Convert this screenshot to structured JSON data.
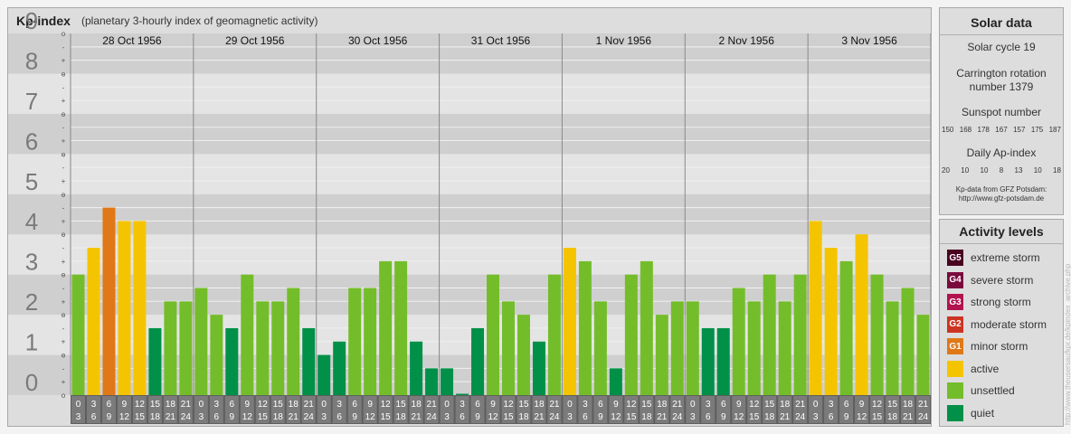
{
  "header": {
    "title": "Kp-index",
    "subtitle": "(planetary 3-hourly index of geomagnetic activity)"
  },
  "chart_data": {
    "type": "bar",
    "ylabel": "",
    "ylim": [
      0,
      9
    ],
    "yticks": [
      "0",
      "1",
      "2",
      "3",
      "4",
      "5",
      "6",
      "7",
      "8",
      "9"
    ],
    "subticks": [
      "+",
      "o",
      "-"
    ],
    "days": [
      "28 Oct 1956",
      "29 Oct 1956",
      "30 Oct 1956",
      "31 Oct 1956",
      "1 Nov 1956",
      "2 Nov 1956",
      "3 Nov 1956"
    ],
    "intervals": [
      [
        "0",
        "3"
      ],
      [
        "3",
        "6"
      ],
      [
        "6",
        "9"
      ],
      [
        "9",
        "12"
      ],
      [
        "12",
        "15"
      ],
      [
        "15",
        "18"
      ],
      [
        "18",
        "21"
      ],
      [
        "21",
        "24"
      ]
    ],
    "values": [
      [
        3.0,
        3.667,
        4.667,
        4.333,
        4.333,
        1.667,
        2.333,
        2.333
      ],
      [
        2.667,
        2.0,
        1.667,
        3.0,
        2.333,
        2.333,
        2.667,
        1.667
      ],
      [
        1.0,
        1.333,
        2.667,
        2.667,
        3.333,
        3.333,
        1.333,
        0.667
      ],
      [
        0.667,
        0.0,
        1.667,
        3.0,
        2.333,
        2.0,
        1.333,
        3.0
      ],
      [
        3.667,
        3.333,
        2.333,
        0.667,
        3.0,
        3.333,
        2.0,
        2.333
      ],
      [
        2.333,
        1.667,
        1.667,
        2.667,
        2.333,
        3.0,
        2.333,
        3.0
      ],
      [
        4.333,
        3.667,
        3.333,
        4.0,
        3.0,
        2.333,
        2.667,
        2.0
      ]
    ],
    "color_rule": "Kp<2 quiet, Kp<=3.5 unsettled, Kp<=4.5 active, Kp>4.5 minor storm"
  },
  "colors": {
    "quiet": "#009048",
    "unsettled": "#74bd2a",
    "active": "#f5c400",
    "minor_storm": "#e07818",
    "moderate_storm": "#cc3322",
    "strong_storm": "#b2134f",
    "severe_storm": "#7a0a3c",
    "extreme_storm": "#4a0220"
  },
  "solar": {
    "title": "Solar data",
    "cycle": "Solar cycle 19",
    "carrington_1": "Carrington rotation",
    "carrington_2": "number 1379",
    "sunspot_title": "Sunspot number",
    "sunspot_values": [
      "150",
      "168",
      "178",
      "167",
      "157",
      "175",
      "187"
    ],
    "ap_title": "Daily Ap-index",
    "ap_values": [
      "20",
      "10",
      "10",
      "8",
      "13",
      "10",
      "18"
    ],
    "source_1": "Kp-data from GFZ Potsdam:",
    "source_2": "http://www.gfz-potsdam.de"
  },
  "activity": {
    "title": "Activity levels",
    "items": [
      {
        "code": "G5",
        "label": "extreme storm",
        "color": "#4a0220"
      },
      {
        "code": "G4",
        "label": "severe storm",
        "color": "#7a0a3c"
      },
      {
        "code": "G3",
        "label": "strong storm",
        "color": "#b2134f"
      },
      {
        "code": "G2",
        "label": "moderate storm",
        "color": "#cc3322"
      },
      {
        "code": "G1",
        "label": "minor storm",
        "color": "#e07818"
      },
      {
        "code": "",
        "label": "active",
        "color": "#f5c400"
      },
      {
        "code": "",
        "label": "unsettled",
        "color": "#74bd2a"
      },
      {
        "code": "",
        "label": "quiet",
        "color": "#009048"
      }
    ]
  },
  "watermark": "http://www.theusersaufkpr.de/kpindex_archive.php"
}
